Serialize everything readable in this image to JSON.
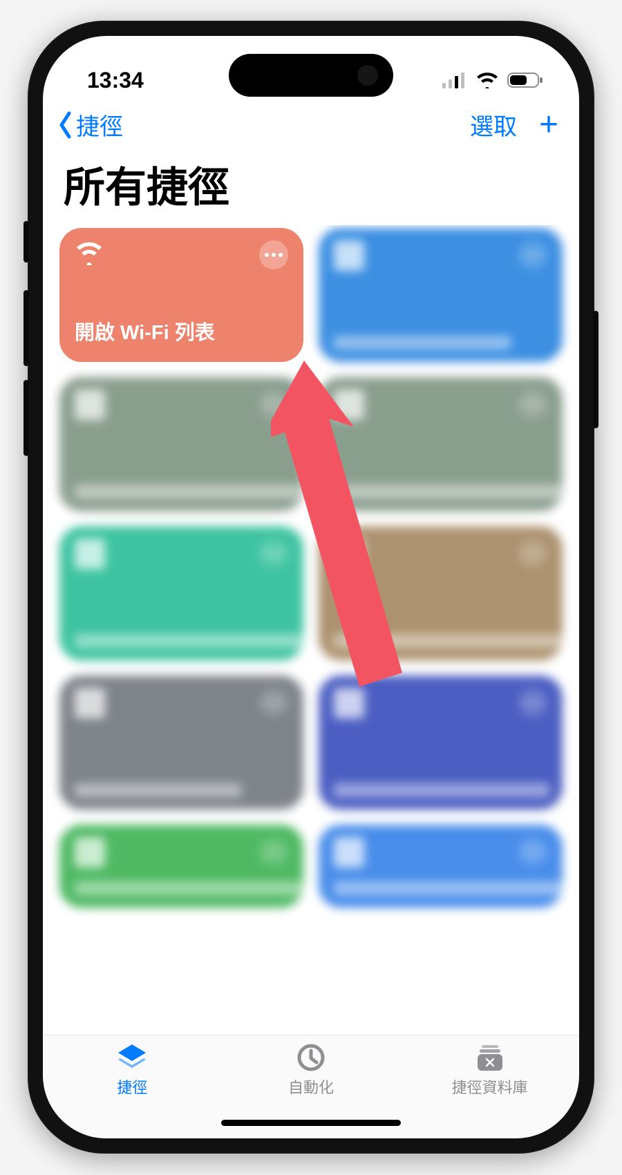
{
  "status": {
    "time": "13:34"
  },
  "nav": {
    "back": "捷徑",
    "select": "選取"
  },
  "title": "所有捷徑",
  "cards": [
    {
      "label": "開啟 Wi-Fi 列表",
      "color": "#ee836d",
      "icon": "wifi"
    },
    {
      "label": "",
      "color": "#3e8fe0",
      "pixelated": true
    },
    {
      "label": "",
      "color": "#8a9d8e",
      "pixelated": true
    },
    {
      "label": "",
      "color": "#8a9d8e",
      "pixelated": true
    },
    {
      "label": "",
      "color": "#3fc2a0",
      "pixelated": true
    },
    {
      "label": "",
      "color": "#ab926f",
      "pixelated": true
    },
    {
      "label": "",
      "color": "#7f848b",
      "pixelated": true
    },
    {
      "label": "",
      "color": "#4d5fc1",
      "pixelated": true
    },
    {
      "label": "",
      "color": "#4fb863",
      "pixelated": true,
      "partial": true
    },
    {
      "label": "",
      "color": "#4a8de8",
      "pixelated": true,
      "partial": true
    }
  ],
  "tabs": {
    "shortcuts": "捷徑",
    "automation": "自動化",
    "gallery": "捷徑資料庫",
    "active": 0
  },
  "colors": {
    "accent": "#007aff",
    "arrow": "#f25561"
  }
}
